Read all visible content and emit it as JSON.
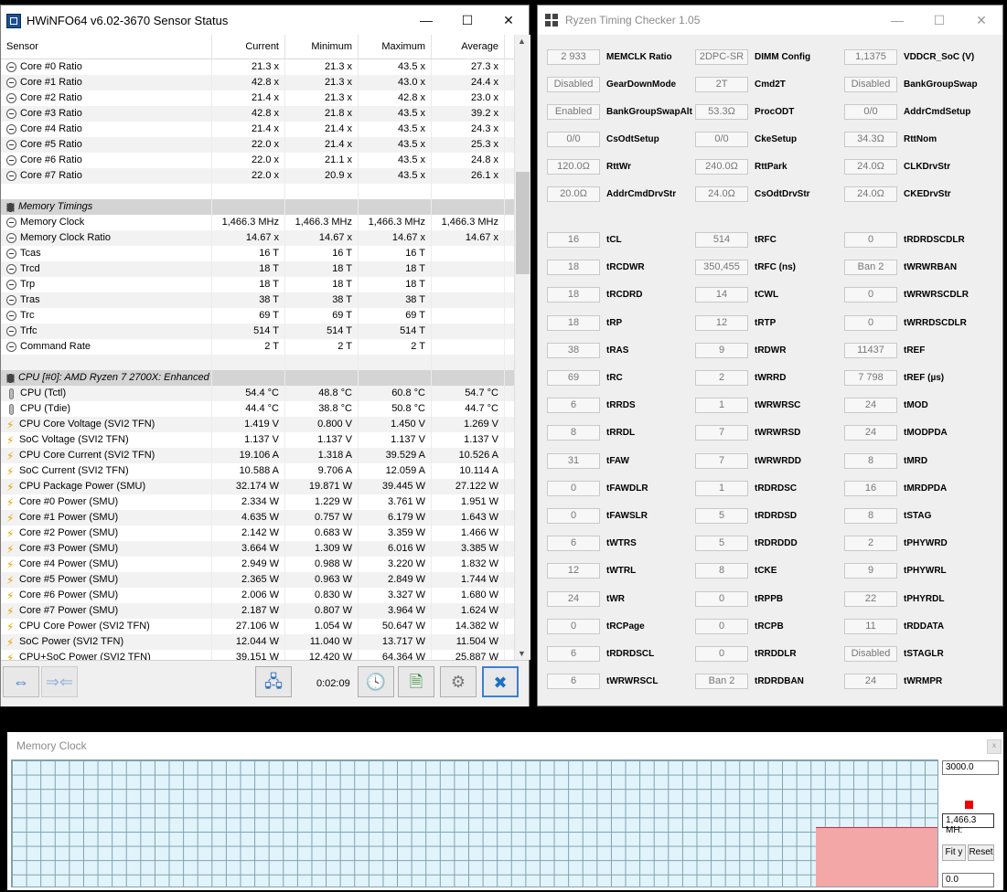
{
  "hwinfo": {
    "title": "HWiNFO64 v6.02-3670 Sensor Status",
    "columns": [
      "Sensor",
      "Current",
      "Minimum",
      "Maximum",
      "Average"
    ],
    "rows": [
      {
        "t": "clock",
        "name": "Core #0 Ratio",
        "v": [
          "21.3 x",
          "21.3 x",
          "43.5 x",
          "27.3 x"
        ]
      },
      {
        "t": "clock",
        "name": "Core #1 Ratio",
        "v": [
          "42.8 x",
          "21.3 x",
          "43.0 x",
          "24.4 x"
        ]
      },
      {
        "t": "clock",
        "name": "Core #2 Ratio",
        "v": [
          "21.4 x",
          "21.3 x",
          "42.8 x",
          "23.0 x"
        ]
      },
      {
        "t": "clock",
        "name": "Core #3 Ratio",
        "v": [
          "42.8 x",
          "21.8 x",
          "43.5 x",
          "39.2 x"
        ]
      },
      {
        "t": "clock",
        "name": "Core #4 Ratio",
        "v": [
          "21.4 x",
          "21.4 x",
          "43.5 x",
          "24.3 x"
        ]
      },
      {
        "t": "clock",
        "name": "Core #5 Ratio",
        "v": [
          "22.0 x",
          "21.4 x",
          "43.5 x",
          "25.3 x"
        ]
      },
      {
        "t": "clock",
        "name": "Core #6 Ratio",
        "v": [
          "22.0 x",
          "21.1 x",
          "43.5 x",
          "24.8 x"
        ]
      },
      {
        "t": "clock",
        "name": "Core #7 Ratio",
        "v": [
          "22.0 x",
          "20.9 x",
          "43.5 x",
          "26.1 x"
        ]
      },
      {
        "t": "blank",
        "name": "",
        "v": [
          "",
          "",
          "",
          ""
        ]
      },
      {
        "t": "section",
        "name": "Memory Timings",
        "v": [
          "",
          "",
          "",
          ""
        ]
      },
      {
        "t": "clock",
        "name": "Memory Clock",
        "v": [
          "1,466.3 MHz",
          "1,466.3 MHz",
          "1,466.3 MHz",
          "1,466.3 MHz"
        ]
      },
      {
        "t": "clock",
        "name": "Memory Clock Ratio",
        "v": [
          "14.67 x",
          "14.67 x",
          "14.67 x",
          "14.67 x"
        ]
      },
      {
        "t": "clock",
        "name": "Tcas",
        "v": [
          "16 T",
          "16 T",
          "16 T",
          ""
        ]
      },
      {
        "t": "clock",
        "name": "Trcd",
        "v": [
          "18 T",
          "18 T",
          "18 T",
          ""
        ]
      },
      {
        "t": "clock",
        "name": "Trp",
        "v": [
          "18 T",
          "18 T",
          "18 T",
          ""
        ]
      },
      {
        "t": "clock",
        "name": "Tras",
        "v": [
          "38 T",
          "38 T",
          "38 T",
          ""
        ]
      },
      {
        "t": "clock",
        "name": "Trc",
        "v": [
          "69 T",
          "69 T",
          "69 T",
          ""
        ]
      },
      {
        "t": "clock",
        "name": "Trfc",
        "v": [
          "514 T",
          "514 T",
          "514 T",
          ""
        ]
      },
      {
        "t": "clock",
        "name": "Command Rate",
        "v": [
          "2 T",
          "2 T",
          "2 T",
          ""
        ]
      },
      {
        "t": "blank",
        "name": "",
        "v": [
          "",
          "",
          "",
          ""
        ]
      },
      {
        "t": "section",
        "name": "CPU [#0]: AMD Ryzen 7 2700X: Enhanced",
        "v": [
          "",
          "",
          "",
          ""
        ]
      },
      {
        "t": "therm",
        "name": "CPU (Tctl)",
        "v": [
          "54.4 °C",
          "48.8 °C",
          "60.8 °C",
          "54.7 °C"
        ]
      },
      {
        "t": "therm",
        "name": "CPU (Tdie)",
        "v": [
          "44.4 °C",
          "38.8 °C",
          "50.8 °C",
          "44.7 °C"
        ]
      },
      {
        "t": "bolt",
        "name": "CPU Core Voltage (SVI2 TFN)",
        "v": [
          "1.419 V",
          "0.800 V",
          "1.450 V",
          "1.269 V"
        ]
      },
      {
        "t": "bolt",
        "name": "SoC Voltage (SVI2 TFN)",
        "v": [
          "1.137 V",
          "1.137 V",
          "1.137 V",
          "1.137 V"
        ]
      },
      {
        "t": "bolt",
        "name": "CPU Core Current (SVI2 TFN)",
        "v": [
          "19.106 A",
          "1.318 A",
          "39.529 A",
          "10.526 A"
        ]
      },
      {
        "t": "bolt",
        "name": "SoC Current (SVI2 TFN)",
        "v": [
          "10.588 A",
          "9.706 A",
          "12.059 A",
          "10.114 A"
        ]
      },
      {
        "t": "bolt",
        "name": "CPU Package Power (SMU)",
        "v": [
          "32.174 W",
          "19.871 W",
          "39.445 W",
          "27.122 W"
        ]
      },
      {
        "t": "bolt",
        "name": "Core #0 Power (SMU)",
        "v": [
          "2.334 W",
          "1.229 W",
          "3.761 W",
          "1.951 W"
        ]
      },
      {
        "t": "bolt",
        "name": "Core #1 Power (SMU)",
        "v": [
          "4.635 W",
          "0.757 W",
          "6.179 W",
          "1.643 W"
        ]
      },
      {
        "t": "bolt",
        "name": "Core #2 Power (SMU)",
        "v": [
          "2.142 W",
          "0.683 W",
          "3.359 W",
          "1.466 W"
        ]
      },
      {
        "t": "bolt",
        "name": "Core #3 Power (SMU)",
        "v": [
          "3.664 W",
          "1.309 W",
          "6.016 W",
          "3.385 W"
        ]
      },
      {
        "t": "bolt",
        "name": "Core #4 Power (SMU)",
        "v": [
          "2.949 W",
          "0.988 W",
          "3.220 W",
          "1.832 W"
        ]
      },
      {
        "t": "bolt",
        "name": "Core #5 Power (SMU)",
        "v": [
          "2.365 W",
          "0.963 W",
          "2.849 W",
          "1.744 W"
        ]
      },
      {
        "t": "bolt",
        "name": "Core #6 Power (SMU)",
        "v": [
          "2.006 W",
          "0.830 W",
          "3.327 W",
          "1.680 W"
        ]
      },
      {
        "t": "bolt",
        "name": "Core #7 Power (SMU)",
        "v": [
          "2.187 W",
          "0.807 W",
          "3.964 W",
          "1.624 W"
        ]
      },
      {
        "t": "bolt",
        "name": "CPU Core Power (SVI2 TFN)",
        "v": [
          "27.106 W",
          "1.054 W",
          "50.647 W",
          "14.382 W"
        ]
      },
      {
        "t": "bolt",
        "name": "SoC Power (SVI2 TFN)",
        "v": [
          "12.044 W",
          "11.040 W",
          "13.717 W",
          "11.504 W"
        ]
      },
      {
        "t": "bolt",
        "name": "CPU+SoC Power (SVI2 TFN)",
        "v": [
          "39.151 W",
          "12.420 W",
          "64.364 W",
          "25.887 W"
        ]
      }
    ],
    "timer": "0:02:09"
  },
  "rtc": {
    "title": "Ryzen Timing Checker 1.05",
    "fields": [
      [
        "2 933",
        "MEMCLK Ratio",
        "2DPC-SR",
        "DIMM Config",
        "1,1375",
        "VDDCR_SoC (V)"
      ],
      [
        "Disabled",
        "GearDownMode",
        "2T",
        "Cmd2T",
        "Disabled",
        "BankGroupSwap"
      ],
      [
        "Enabled",
        "BankGroupSwapAlt",
        "53.3Ω",
        "ProcODT",
        "0/0",
        "AddrCmdSetup"
      ],
      [
        "0/0",
        "CsOdtSetup",
        "0/0",
        "CkeSetup",
        "34.3Ω",
        "RttNom"
      ],
      [
        "120.0Ω",
        "RttWr",
        "240.0Ω",
        "RttPark",
        "24.0Ω",
        "CLKDrvStr"
      ],
      [
        "20.0Ω",
        "AddrCmdDrvStr",
        "24.0Ω",
        "CsOdtDrvStr",
        "24.0Ω",
        "CKEDrvStr"
      ]
    ],
    "timings": [
      [
        "16",
        "tCL",
        "514",
        "tRFC",
        "0",
        "tRDRDSCDLR"
      ],
      [
        "18",
        "tRCDWR",
        "350,455",
        "tRFC (ns)",
        "Ban 2",
        "tWRWRBAN"
      ],
      [
        "18",
        "tRCDRD",
        "14",
        "tCWL",
        "0",
        "tWRWRSCDLR"
      ],
      [
        "18",
        "tRP",
        "12",
        "tRTP",
        "0",
        "tWRRDSCDLR"
      ],
      [
        "38",
        "tRAS",
        "9",
        "tRDWR",
        "11437",
        "tREF"
      ],
      [
        "69",
        "tRC",
        "2",
        "tWRRD",
        "7 798",
        "tREF (µs)"
      ],
      [
        "6",
        "tRRDS",
        "1",
        "tWRWRSC",
        "24",
        "tMOD"
      ],
      [
        "8",
        "tRRDL",
        "7",
        "tWRWRSD",
        "24",
        "tMODPDA"
      ],
      [
        "31",
        "tFAW",
        "7",
        "tWRWRDD",
        "8",
        "tMRD"
      ],
      [
        "0",
        "tFAWDLR",
        "1",
        "tRDRDSC",
        "16",
        "tMRDPDA"
      ],
      [
        "0",
        "tFAWSLR",
        "5",
        "tRDRDSD",
        "8",
        "tSTAG"
      ],
      [
        "6",
        "tWTRS",
        "5",
        "tRDRDDD",
        "2",
        "tPHYWRD"
      ],
      [
        "12",
        "tWTRL",
        "8",
        "tCKE",
        "9",
        "tPHYWRL"
      ],
      [
        "24",
        "tWR",
        "0",
        "tRPPB",
        "22",
        "tPHYRDL"
      ],
      [
        "0",
        "tRCPage",
        "0",
        "tRCPB",
        "11",
        "tRDDATA"
      ],
      [
        "6",
        "tRDRDSCL",
        "0",
        "tRRDDLR",
        "Disabled",
        "tSTAGLR"
      ],
      [
        "6",
        "tWRWRSCL",
        "Ban 2",
        "tRDRDBAN",
        "24",
        "tWRMPR"
      ]
    ]
  },
  "memclock": {
    "title": "Memory Clock",
    "max_label": "3000.0",
    "current_label": "1,466.3 MH:",
    "min_label": "0.0",
    "fit_label": "Fit y",
    "reset_label": "Reset",
    "current_fraction": 0.4888
  }
}
